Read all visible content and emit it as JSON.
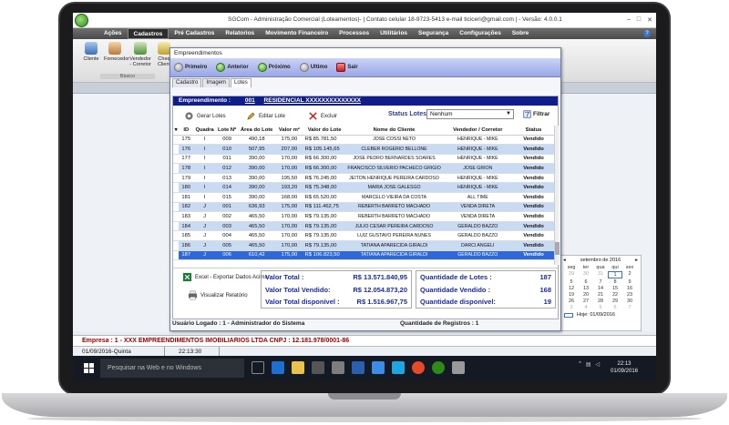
{
  "window": {
    "title": "SGCom - Administração Comercial (Loteamentos)- | Contato celular 18-9723-5413 e-mail ticiceri@gmail.com | - Versão: 4.0.0.1",
    "controls": [
      "–",
      "□",
      "✕"
    ]
  },
  "menu": {
    "items": [
      "Ações",
      "Cadastros",
      "Pré Cadastros",
      "Relatorios",
      "Movimento Financeiro",
      "Processos",
      "Utilitários",
      "Segurança",
      "Configurações",
      "Sobre"
    ],
    "help": "?"
  },
  "ribbon": {
    "buttons": [
      "Cliente",
      "Fornecedor",
      "Vendedor - Corretor",
      "Cheq Client"
    ],
    "group": "Básico"
  },
  "dialog": {
    "title": "Empreendimentos",
    "nav": [
      "Primeiro",
      "Anterior",
      "Próximo",
      "Ultimo",
      "Sair"
    ],
    "tabs": [
      "Cadastro",
      "Imagem",
      "Lotes"
    ],
    "empreendimento_label": "Empreendimento :",
    "empreendimento_num": "001",
    "empreendimento_name": "RESIDENCIAL XXXXXXXXXXXXXX",
    "toolbar": {
      "gerar": "Gerar Lotes",
      "editar": "Editar Lote",
      "excluir": "Excluir",
      "status_label": "Status Lotes",
      "status_value": "Nenhum",
      "filtrar": "Filtrar"
    },
    "table": {
      "headers": [
        "ID",
        "Quadra",
        "Lote Nº",
        "Área do Lote",
        "Valor m²",
        "Valor do Lote",
        "Nome do Cliente",
        "Vendedor / Corretor",
        "Status"
      ],
      "rows": [
        [
          "175",
          "I",
          "009",
          "490,18",
          "175,00",
          "R$ 85.781,50",
          "JOSE COSSI NETO",
          "HENRIQUE - MIKE",
          "Vendido"
        ],
        [
          "176",
          "I",
          "010",
          "507,95",
          "207,00",
          "R$ 105.145,65",
          "CLEBER ROGERIO BELLONE",
          "HENRIQUE - MIKE",
          "Vendido"
        ],
        [
          "177",
          "I",
          "011",
          "390,00",
          "170,00",
          "R$ 66.300,00",
          "JOSE PEDRO BERNARDES SOARES",
          "HENRIQUE - MIKE",
          "Vendido"
        ],
        [
          "178",
          "I",
          "012",
          "390,00",
          "170,00",
          "R$ 66.300,00",
          "FRANCISCO SILVERIO PACHECO GRIGIO",
          "JOSE GRION",
          "Vendido"
        ],
        [
          "179",
          "I",
          "013",
          "390,00",
          "195,50",
          "R$ 76.245,00",
          "JEITON HENRIQUE PEREIRA CARDOSO",
          "HENRIQUE - MIKE",
          "Vendido"
        ],
        [
          "180",
          "I",
          "014",
          "390,00",
          "193,20",
          "R$ 75.348,00",
          "MARIA JOSE GALESGO",
          "HENRIQUE - MIKE",
          "Vendido"
        ],
        [
          "181",
          "I",
          "015",
          "390,00",
          "168,00",
          "R$ 65.520,00",
          "MARCELO VIEIRA DA COSTA",
          "ALL TIME",
          "Vendido"
        ],
        [
          "182",
          "J",
          "001",
          "636,93",
          "175,00",
          "R$ 111.462,75",
          "REBERTH BARRETO MACHADO",
          "VENDA DIRETA",
          "Vendido"
        ],
        [
          "183",
          "J",
          "002",
          "465,50",
          "170,00",
          "R$ 79.135,00",
          "REBERTH BARRETO MACHADO",
          "VENDA DIRETA",
          "Vendido"
        ],
        [
          "184",
          "J",
          "003",
          "465,50",
          "170,00",
          "R$ 79.135,00",
          "JULIO CESAR PEREIRA CARDOSO",
          "GERALDO BAZZO",
          "Vendido"
        ],
        [
          "185",
          "J",
          "004",
          "465,50",
          "170,00",
          "R$ 79.135,00",
          "LUIZ GUSTAVO PEREIRA NUNES",
          "GERALDO BAZZO",
          "Vendido"
        ],
        [
          "186",
          "J",
          "005",
          "465,50",
          "170,00",
          "R$ 79.135,00",
          "TATIANA APARECIDA GIRALDI",
          "DARCI ANGELI",
          "Vendido"
        ],
        [
          "187",
          "J",
          "006",
          "610,42",
          "175,00",
          "R$ 106.823,50",
          "TATIANA APARECIDA GIRALDI",
          "GERALDO BAZZO",
          "Vendido"
        ]
      ]
    },
    "actions": {
      "excel": "Excel - Exportar Dados Acima",
      "report": "Visualizar Relatório"
    },
    "totals": {
      "valor_total_label": "Valor Total :",
      "valor_total": "R$ 13.571.840,95",
      "valor_vendido_label": "Valor Total Vendido:",
      "valor_vendido": "R$ 12.054.873,20",
      "valor_disponivel_label": "Valor Total disponível :",
      "valor_disponivel": "R$ 1.516.967,75",
      "qtd_lotes_label": "Quantidade de Lotes :",
      "qtd_lotes": "187",
      "qtd_vendido_label": "Quantidade Vendido :",
      "qtd_vendido": "168",
      "qtd_disponivel_label": "Quantidade disponível:",
      "qtd_disponivel": "19"
    },
    "footer": {
      "usuario": "Usuário Logado : 1 - Administrador do Sistema",
      "registros": "Quantidade de Registros : 1"
    }
  },
  "calendar": {
    "month": "setembro de 2016",
    "days_header": [
      "seg",
      "ter",
      "qua",
      "qui",
      "sex"
    ],
    "weeks": [
      [
        "29",
        "30",
        "31",
        "1",
        "2"
      ],
      [
        "5",
        "6",
        "7",
        "8",
        "9"
      ],
      [
        "12",
        "13",
        "14",
        "15",
        "16"
      ],
      [
        "19",
        "20",
        "21",
        "22",
        "23"
      ],
      [
        "26",
        "27",
        "28",
        "29",
        "30"
      ],
      [
        "3",
        "4",
        "5",
        "6",
        "7"
      ]
    ],
    "today_label": "Hoje: 01/09/2016"
  },
  "status": {
    "empresa": "Empresa : 1 - XXX EMPREENDIMENTOS IMOBILIARIOS LTDA  CNPJ : 12.181.978/0001-86",
    "date": "01/09/2016-Quinta",
    "time": "22:13:30"
  },
  "taskbar": {
    "search_placeholder": "Pesquisar na Web e no Windows",
    "clock_time": "22:13",
    "clock_date": "01/09/2016"
  }
}
